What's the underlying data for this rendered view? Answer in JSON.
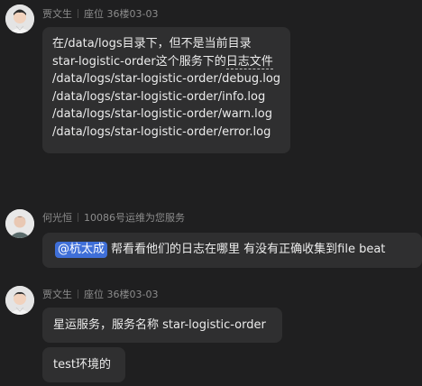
{
  "messages": [
    {
      "sender": "贾文生",
      "meta": "座位 36楼03-03",
      "lines": [
        "在/data/logs目录下，但不是当前目录",
        "star-logistic-order这个服务下的",
        "日志文件",
        "/data/logs/star-logistic-order/debug.log",
        "/data/logs/star-logistic-order/info.log",
        "/data/logs/star-logistic-order/warn.log",
        "/data/logs/star-logistic-order/error.log"
      ]
    },
    {
      "sender": "何光恒",
      "meta": "10086号运维为您服务",
      "mention": "@杭太成",
      "text": "帮看看他们的日志在哪里  有没有正确收集到file beat"
    },
    {
      "sender": "贾文生",
      "meta": "座位 36楼03-03",
      "bubbles": [
        "星运服务，服务名称 star-logistic-order",
        "test环境的"
      ]
    }
  ],
  "colors": {
    "background": "#1f1f20",
    "bubble": "#2f2f30",
    "mention": "#3f6fd8"
  }
}
